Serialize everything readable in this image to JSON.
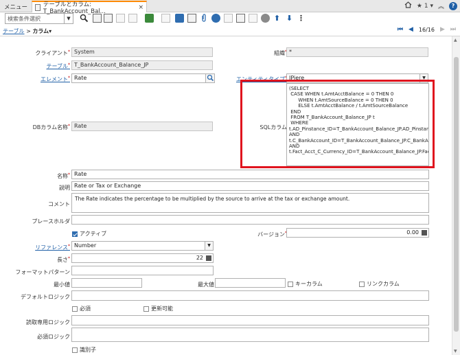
{
  "tabs": {
    "menu_label": "メニュー",
    "active_label": "テーブルとカラム: T_BankAccount_Bal...",
    "close_symbol": "×"
  },
  "top_right": {
    "count": "1",
    "help_label": "?"
  },
  "toolbar": {
    "search_placeholder": "検索条件選択"
  },
  "breadcrumb": {
    "parent": "テーブル",
    "separator": ">",
    "current": "カラム"
  },
  "record_nav": {
    "counter": "16/16"
  },
  "form": {
    "client_label": "クライアント",
    "client_value": "System",
    "org_label": "組織",
    "org_value": "*",
    "table_label": "テーブル",
    "table_value": "T_BankAccount_Balance_JP",
    "element_label": "エレメント",
    "element_value": "Rate",
    "entity_type_label": "エンティティタイプ",
    "entity_type_value": "JPiere",
    "db_column_label": "DBカラム名称",
    "db_column_value": "Rate",
    "sql_column_label": "SQLカラム",
    "sql_column_value": "(SELECT\n CASE WHEN t.AmtAcctBalance = 0 THEN 0\n      WHEN t.AmtSourceBalance = 0 THEN 0\n      ELSE t.AmtAcctBalance / t.AmtSourceBalance\n END\n FROM T_BankAccount_Balance_JP t\n WHERE\nt.AD_Pinstance_ID=T_BankAccount_Balance_JP.AD_Pinstance_ID AND\nt.C_BankAccount_ID=T_BankAccount_Balance_JP.C_BankAccount_ID AND\nt.Fact_Acct_C_Currency_ID=T_BankAccount_Balance_JP.Fact_Acct_C_Currency_ID)",
    "name_label": "名称",
    "name_value": "Rate",
    "description_label": "説明",
    "description_value": "Rate or Tax or Exchange",
    "comment_label": "コメント",
    "comment_value": "The Rate indicates the percentage to be multiplied by the source to arrive at the tax or exchange amount.",
    "placeholder_label": "プレースホルダ",
    "placeholder_value": "",
    "active_label": "アクティブ",
    "active_checked": true,
    "version_label": "バージョン",
    "version_value": "0.00",
    "reference_label": "リファレンス",
    "reference_value": "Number",
    "length_label": "長さ",
    "length_value": "22",
    "format_pattern_label": "フォーマットパターン",
    "format_pattern_value": "",
    "min_value_label": "最小値",
    "min_value_value": "",
    "max_value_label": "最大値",
    "max_value_value": "",
    "key_column_label": "キーカラム",
    "link_column_label": "リンクカラム",
    "default_logic_label": "デフォルトロジック",
    "default_logic_value": "",
    "mandatory_label": "必須",
    "updatable_label": "更新可能",
    "readonly_logic_label": "読取専用ロジック",
    "readonly_logic_value": "",
    "mandatory_logic_label": "必須ロジック",
    "mandatory_logic_value": "",
    "identifier_label": "識別子"
  },
  "colors": {
    "accent_blue": "#1f5fa6",
    "active_tab_orange": "#ff8a00",
    "highlight_red": "#e0141e",
    "readonly_bg": "#eeeeee"
  },
  "icons": [
    "home-icon",
    "help-icon",
    "search-icon",
    "new-record-icon",
    "copy-icon",
    "delete-icon",
    "save-icon",
    "refresh-icon",
    "attachment-icon",
    "zoom-icon",
    "print-icon",
    "settings-icon",
    "arrow-up-icon",
    "arrow-down-icon",
    "more-icon"
  ]
}
